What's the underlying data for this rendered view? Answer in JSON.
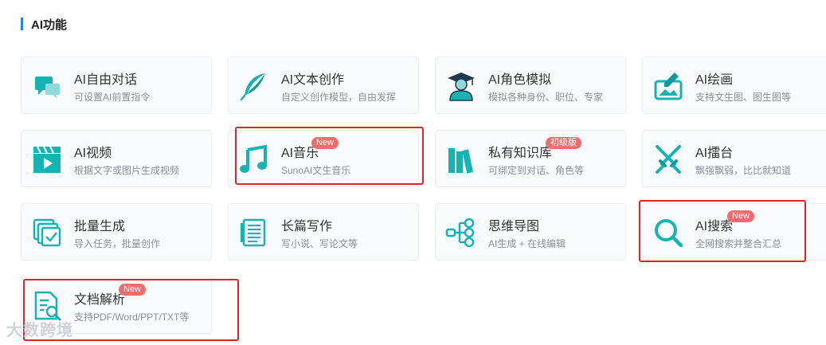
{
  "section": {
    "title": "AI功能"
  },
  "cards": [
    {
      "title": "AI自由对话",
      "desc": "可设置AI前置指令",
      "icon": "chat-bubbles-icon"
    },
    {
      "title": "AI文本创作",
      "desc": "自定义创作模型，自由发挥",
      "icon": "feather-quill-icon"
    },
    {
      "title": "AI角色模拟",
      "desc": "模拟各种身份、职位、专家",
      "icon": "graduate-avatar-icon"
    },
    {
      "title": "AI绘画",
      "desc": "支持文生图、图生图等",
      "icon": "paint-brush-canvas-icon"
    },
    {
      "title": "AI视频",
      "desc": "根据文字或图片生成视频",
      "icon": "clapperboard-play-icon"
    },
    {
      "title": "AI音乐",
      "desc": "SunoAI文生音乐",
      "icon": "music-note-icon",
      "badge": "New"
    },
    {
      "title": "私有知识库",
      "desc": "可绑定到对话、角色等",
      "icon": "books-icon",
      "badge": "初级版"
    },
    {
      "title": "AI擂台",
      "desc": "飘强飘弱，比比就知道",
      "icon": "crossed-swords-icon"
    },
    {
      "title": "批量生成",
      "desc": "导入任务，批量创作",
      "icon": "stacked-check-icon"
    },
    {
      "title": "长篇写作",
      "desc": "写小说、写论文等",
      "icon": "document-lines-icon"
    },
    {
      "title": "思维导图",
      "desc": "AI生成 + 在线编辑",
      "icon": "mind-map-icon"
    },
    {
      "title": "AI搜索",
      "desc": "全网搜索并整合汇总",
      "icon": "magnifier-icon",
      "badge": "New"
    },
    {
      "title": "文档解析",
      "desc": "支持PDF/Word/PPT/TXT等",
      "icon": "document-search-icon",
      "badge": "New"
    }
  ],
  "watermark": "大数跨境",
  "colors": {
    "accent": "#1e88e5",
    "icon": "#17b3b3",
    "badge": "#f26b6b",
    "highlight": "#e0252a"
  }
}
